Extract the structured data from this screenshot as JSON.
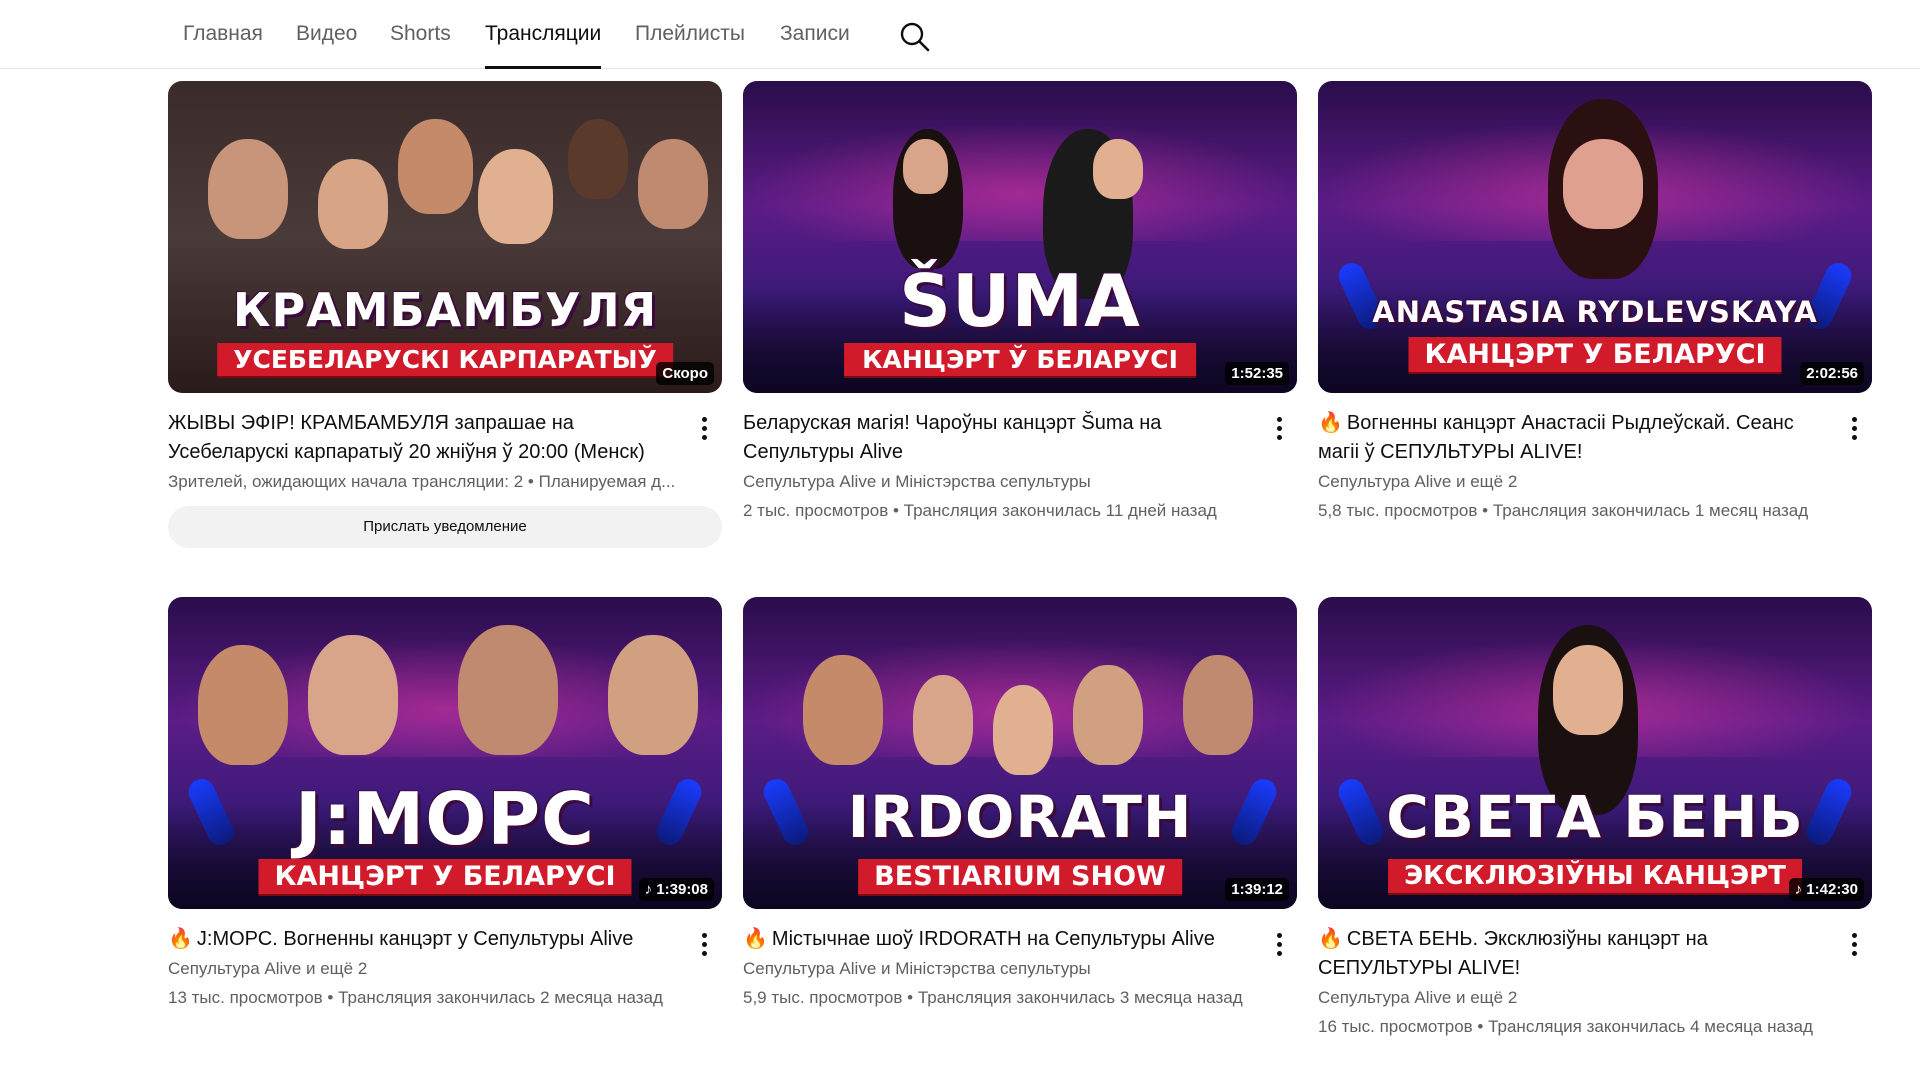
{
  "tabs": [
    {
      "label": "Главная"
    },
    {
      "label": "Видео"
    },
    {
      "label": "Shorts"
    },
    {
      "label": "Трансляции",
      "active": true
    },
    {
      "label": "Плейлисты"
    },
    {
      "label": "Записи"
    }
  ],
  "search": {
    "icon": "search-icon"
  },
  "videos": [
    {
      "thumb_title": "КРАМБАМБУЛЯ",
      "thumb_banner": "УСЕБЕЛАРУСКІ КАРПАРАТЫЎ",
      "badge": "Скоро",
      "fire": false,
      "title": "ЖЫВЫ ЭФІР! КРАМБАМБУЛЯ запрашае на Усебеларускі карпаратыў 20 жніўня ў 20:00 (Менск)",
      "line1": "Зрителей, ожидающих начала трансляции: 2 • Планируемая д...",
      "line2": "",
      "button": "Прислать уведомление"
    },
    {
      "thumb_title": "ŠUMA",
      "thumb_banner": "КАНЦЭРТ Ў БЕЛАРУСІ",
      "badge": "1:52:35",
      "fire": false,
      "title": "Беларуская магія! Чароўны канцэрт Šuma на Сепультуры Alive",
      "line1": "Сепультура Alive и Міністэрства сепультуры",
      "line2": "2 тыс. просмотров • Трансляция закончилась 11 дней назад"
    },
    {
      "thumb_title": "ANASTASIA RYDLEVSKAYA",
      "thumb_banner": "КАНЦЭРТ У БЕЛАРУСІ",
      "badge": "2:02:56",
      "fire": true,
      "title": "Вогненны канцэрт Анастасіі Рыдлеўскай. Сеанс магіі ў СЕПУЛЬТУРЫ ALIVE!",
      "line1": "Сепультура Alive и ещё 2",
      "line2": "5,8 тыс. просмотров • Трансляция закончилась 1 месяц назад"
    },
    {
      "thumb_title": "J:МОРС",
      "thumb_banner": "КАНЦЭРТ У БЕЛАРУСІ",
      "badge": "♪ 1:39:08",
      "fire": true,
      "title": "J:МОРС. Вогненны канцэрт у Сепультуры Alive",
      "line1": "Сепультура Alive и ещё 2",
      "line2": "13 тыс. просмотров • Трансляция закончилась 2 месяца назад"
    },
    {
      "thumb_title": "IRDORATH",
      "thumb_banner": "BESTIARIUM SHOW",
      "badge": "1:39:12",
      "fire": true,
      "title": "Містычнае шоў IRDORATH на Сепультуры Alive",
      "line1": "Сепультура Alive и Міністэрства сепультуры",
      "line2": "5,9 тыс. просмотров • Трансляция закончилась 3 месяца назад"
    },
    {
      "thumb_title": "СВЕТА БЕНЬ",
      "thumb_banner": "ЭКСКЛЮЗІЎНЫ КАНЦЭРТ",
      "badge": "♪ 1:42:30",
      "fire": true,
      "title": "СВЕТА БЕНЬ. Эксклюзіўны канцэрт на СЕПУЛЬТУРЫ ALIVE!",
      "line1": "Сепультура Alive и ещё 2",
      "line2": "16 тыс. просмотров • Трансляция закончилась 4 месяца назад"
    }
  ],
  "colors": {
    "accent": "#d11a2a",
    "text": "#0f0f0f",
    "secondary": "#606060",
    "fire": "#f06a0a"
  }
}
